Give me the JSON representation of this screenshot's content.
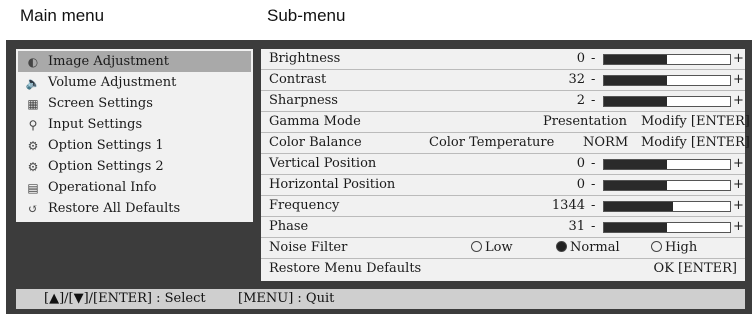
{
  "headers": {
    "main": "Main menu",
    "sub": "Sub-menu"
  },
  "main_menu": {
    "items": [
      {
        "label": "Image Adjustment",
        "icon": "image-adjust-icon",
        "glyph": "◐",
        "selected": true
      },
      {
        "label": "Volume Adjustment",
        "icon": "speaker-icon",
        "glyph": "🔈",
        "selected": false
      },
      {
        "label": "Screen Settings",
        "icon": "screen-icon",
        "glyph": "▦",
        "selected": false
      },
      {
        "label": "Input Settings",
        "icon": "input-icon",
        "glyph": "⚲",
        "selected": false
      },
      {
        "label": "Option Settings 1",
        "icon": "options-icon",
        "glyph": "⚙",
        "selected": false
      },
      {
        "label": "Option Settings 2",
        "icon": "options-icon",
        "glyph": "⚙",
        "selected": false
      },
      {
        "label": "Operational Info",
        "icon": "info-icon",
        "glyph": "▤",
        "selected": false
      },
      {
        "label": "Restore All Defaults",
        "icon": "restore-icon",
        "glyph": "↺",
        "selected": false
      }
    ]
  },
  "sub_menu": {
    "brightness": {
      "label": "Brightness",
      "value": "0",
      "level": 0.5
    },
    "contrast": {
      "label": "Contrast",
      "value": "32",
      "level": 0.5
    },
    "sharpness": {
      "label": "Sharpness",
      "value": "2",
      "level": 0.5
    },
    "gamma": {
      "label": "Gamma Mode",
      "value": "Presentation",
      "action": "Modify [ENTER]"
    },
    "color_balance": {
      "label": "Color Balance",
      "mode": "Color Temperature",
      "value": "NORM",
      "action": "Modify [ENTER]"
    },
    "vertical": {
      "label": "Vertical Position",
      "value": "0",
      "level": 0.5
    },
    "horizontal": {
      "label": "Horizontal Position",
      "value": "0",
      "level": 0.5
    },
    "frequency": {
      "label": "Frequency",
      "value": "1344",
      "level": 0.55
    },
    "phase": {
      "label": "Phase",
      "value": "31",
      "level": 0.5
    },
    "noise_filter": {
      "label": "Noise Filter",
      "options": [
        "Low",
        "Normal",
        "High"
      ],
      "selected": "Normal"
    },
    "restore": {
      "label": "Restore Menu Defaults",
      "action": "OK [ENTER]"
    },
    "minus": "-",
    "plus": "+"
  },
  "status_bar": {
    "select": "[▲]/[▼]/[ENTER] : Select",
    "quit": "[MENU] : Quit"
  }
}
